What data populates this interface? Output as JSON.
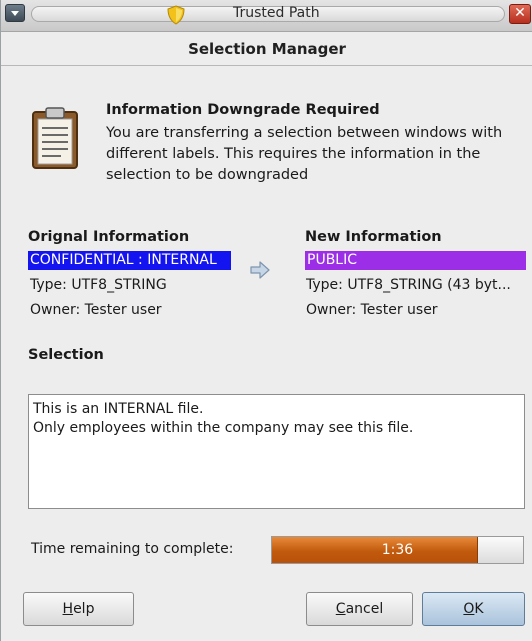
{
  "window": {
    "title": "Trusted Path",
    "close_symbol": "✕"
  },
  "dialog": {
    "header": "Selection Manager",
    "info_title": "Information Downgrade Required",
    "info_text": "You are transferring a selection between windows with different labels.  This requires the information in the selection to be downgraded"
  },
  "original": {
    "heading": "Orignal Information",
    "label": "CONFIDENTIAL : INTERNAL",
    "label_color": "#1414f0",
    "type": "Type: UTF8_STRING",
    "owner": "Owner: Tester user"
  },
  "new_info": {
    "heading": "New Information",
    "label": "PUBLIC",
    "label_color": "#9b2ee6",
    "type": "Type: UTF8_STRING (43 byt...",
    "owner": "Owner: Tester user"
  },
  "selection": {
    "heading": "Selection",
    "lines": [
      "This is an INTERNAL file.",
      "Only employees within the company may see this file."
    ]
  },
  "timer": {
    "label": "Time remaining to complete:",
    "value": "1:36",
    "progress_fraction": 0.82
  },
  "buttons": {
    "help_mnemonic": "H",
    "help_rest": "elp",
    "cancel_mnemonic": "C",
    "cancel_rest": "ancel",
    "ok_mnemonic": "O",
    "ok_rest": "K"
  },
  "icons": {
    "window_menu": "chevron-down-icon",
    "title": "shield-icon",
    "info": "clipboard-icon",
    "transfer": "arrow-right-icon"
  }
}
